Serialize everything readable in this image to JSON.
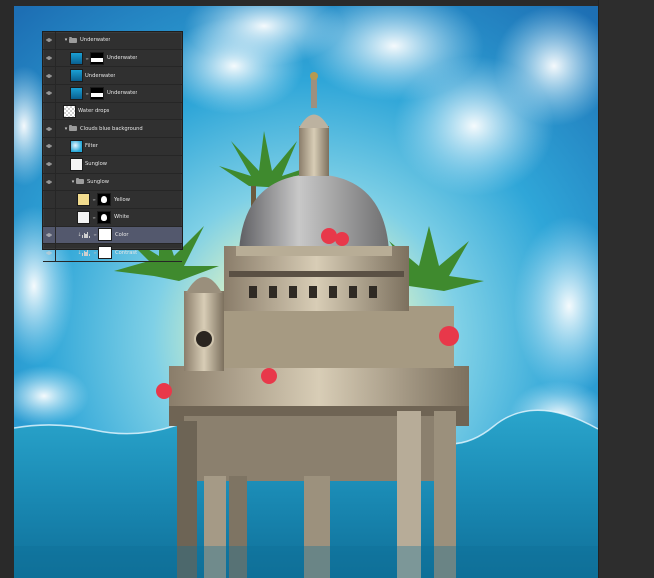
{
  "layers_panel": {
    "rows": [
      {
        "kind": "group",
        "name": "Underwater",
        "visible": true,
        "indent": 1
      },
      {
        "kind": "layer",
        "name": "Underwater",
        "visible": true,
        "thumb": "water",
        "mask": "split",
        "indent": 2
      },
      {
        "kind": "layer",
        "name": "Underwater",
        "visible": true,
        "thumb": "water",
        "mask": "none",
        "indent": 2
      },
      {
        "kind": "layer",
        "name": "Underwater",
        "visible": true,
        "thumb": "water",
        "mask": "split",
        "indent": 2
      },
      {
        "kind": "layer",
        "name": "Water drops",
        "visible": false,
        "thumb": "checker",
        "mask": "none",
        "indent": 1
      },
      {
        "kind": "group",
        "name": "Clouds blue background",
        "visible": true,
        "indent": 1
      },
      {
        "kind": "layer",
        "name": "Filter",
        "visible": true,
        "thumb": "filter",
        "mask": "none",
        "indent": 2
      },
      {
        "kind": "layer",
        "name": "Sunglow",
        "visible": true,
        "thumb": "white",
        "mask": "none",
        "indent": 2
      },
      {
        "kind": "group",
        "name": "Sunglow",
        "visible": true,
        "indent": 2
      },
      {
        "kind": "layer",
        "name": "Yellow",
        "visible": false,
        "thumb": "yellow",
        "mask": "blob",
        "indent": 3
      },
      {
        "kind": "layer",
        "name": "White",
        "visible": false,
        "thumb": "white",
        "mask": "blob",
        "indent": 3
      },
      {
        "kind": "adjustment",
        "name": "Color",
        "visible": true,
        "mask": "white",
        "indent": 3,
        "selected": true
      },
      {
        "kind": "adjustment",
        "name": "Contrast",
        "visible": true,
        "mask": "white",
        "indent": 3
      }
    ]
  },
  "colors": {
    "sky_top": "#2f86c9",
    "sky_glow": "#fff6b8",
    "water": "#1b8fb8",
    "selection": "#53586d"
  },
  "icons": {
    "visibility": "eye-icon",
    "group": "folder-icon",
    "expand": "chevron-down-icon",
    "link": "link-icon",
    "adjustment": "levels-icon",
    "clipping": "clip-arrow-icon"
  }
}
